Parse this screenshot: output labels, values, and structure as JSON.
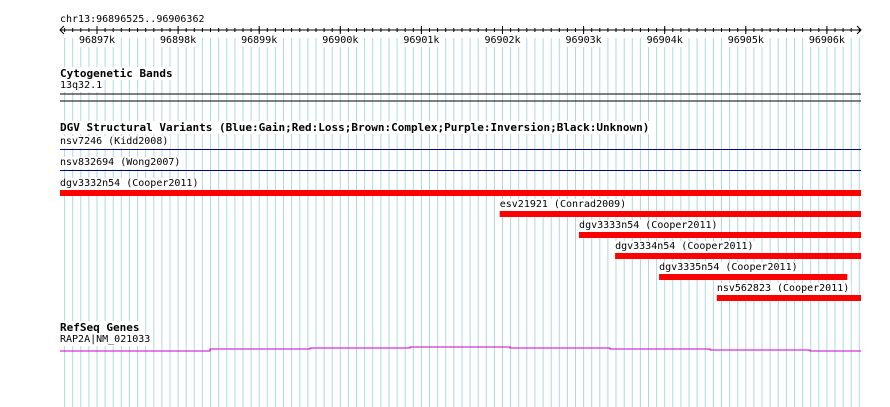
{
  "ruler": {
    "location_label": "chr13:96896525..96906362",
    "ticks": [
      "96897k",
      "96898k",
      "96899k",
      "96900k",
      "96901k",
      "96902k",
      "96903k",
      "96904k",
      "96905k",
      "96906k"
    ]
  },
  "cytoband": {
    "title": "Cytogenetic Bands",
    "band_label": "13q32.1"
  },
  "dgv": {
    "title": "DGV Structural Variants (Blue:Gain;Red:Loss;Brown:Complex;Purple:Inversion;Black:Unknown)",
    "variants": [
      {
        "label": "nsv7246 (Kidd2008)",
        "type": "gain",
        "color": "#00008b",
        "start": 0.0,
        "end": 1.0
      },
      {
        "label": "nsv832694 (Wong2007)",
        "type": "gain",
        "color": "#00008b",
        "start": 0.0,
        "end": 1.0
      },
      {
        "label": "dgv3332n54 (Cooper2011)",
        "type": "loss",
        "color": "#ff0000",
        "start": 0.0,
        "end": 1.0
      },
      {
        "label": "esv21921 (Conrad2009)",
        "type": "loss",
        "color": "#ff0000",
        "start": 0.549,
        "end": 1.0
      },
      {
        "label": "dgv3333n54 (Cooper2011)",
        "type": "loss",
        "color": "#ff0000",
        "start": 0.648,
        "end": 1.0
      },
      {
        "label": "dgv3334n54 (Cooper2011)",
        "type": "loss",
        "color": "#ff0000",
        "start": 0.693,
        "end": 1.0
      },
      {
        "label": "dgv3335n54 (Cooper2011)",
        "type": "loss",
        "color": "#ff0000",
        "start": 0.748,
        "end": 0.983
      },
      {
        "label": "nsv562823 (Cooper2011)",
        "type": "loss",
        "color": "#ff0000",
        "start": 0.82,
        "end": 1.0
      }
    ]
  },
  "refseq": {
    "title": "RefSeq Genes",
    "gene_label": "RAP2A|NM_021033",
    "color": "#cc00cc"
  },
  "colors": {
    "grid": "#add8e6",
    "ruler": "#000000",
    "loss": "#ff0000",
    "gain": "#00008b",
    "gene": "#cc00cc"
  }
}
